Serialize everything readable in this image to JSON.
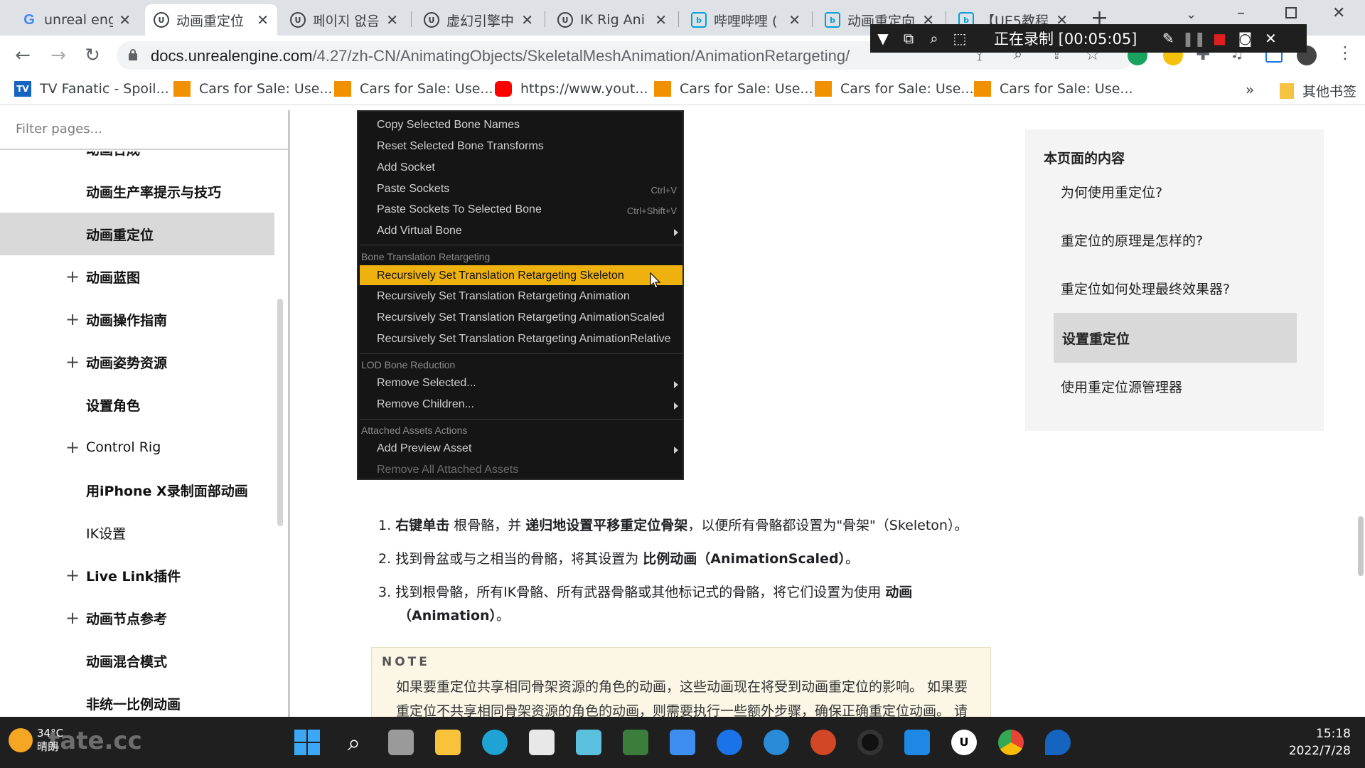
{
  "tabs": [
    {
      "title": "unreal eng",
      "icon": "google-icon",
      "active": false
    },
    {
      "title": "动画重定位",
      "icon": "unreal-icon",
      "active": true
    },
    {
      "title": "페이지 없음",
      "icon": "unreal-icon",
      "active": false
    },
    {
      "title": "虚幻引擎中",
      "icon": "unreal-icon",
      "active": false
    },
    {
      "title": "IK Rig Ani",
      "icon": "unreal-icon",
      "active": false
    },
    {
      "title": "哔哩哔哩 (",
      "icon": "bilibili-icon",
      "active": false
    },
    {
      "title": "动画重定向",
      "icon": "bilibili-icon",
      "active": false
    },
    {
      "title": "【UE5教程",
      "icon": "bilibili-icon",
      "active": false
    }
  ],
  "address": {
    "host": "docs.unrealengine.com",
    "path": "/4.27/zh-CN/AnimatingObjects/SkeletalMeshAnimation/AnimationRetargeting/"
  },
  "recorder": {
    "status": "正在录制 [00:05:05]"
  },
  "bookmarks": [
    {
      "label": "TV Fanatic - Spoil...",
      "icon": "tv-fanatic-icon"
    },
    {
      "label": "Cars for Sale: Use...",
      "icon": "cars-icon"
    },
    {
      "label": "Cars for Sale: Use...",
      "icon": "cars-icon"
    },
    {
      "label": "https://www.yout...",
      "icon": "youtube-icon"
    },
    {
      "label": "Cars for Sale: Use...",
      "icon": "cars-icon"
    },
    {
      "label": "Cars for Sale: Use...",
      "icon": "cars-icon"
    },
    {
      "label": "Cars for Sale: Use...",
      "icon": "cars-icon"
    }
  ],
  "bookmarks_more": "»",
  "bookmarks_other": "其他书签",
  "sidebar": {
    "filter_placeholder": "Filter pages...",
    "items": [
      {
        "label": "动画合成",
        "expandable": false
      },
      {
        "label": "动画生产率提示与技巧",
        "expandable": false
      },
      {
        "label": "动画重定位",
        "expandable": false,
        "active": true
      },
      {
        "label": "动画蓝图",
        "expandable": true
      },
      {
        "label": "动画操作指南",
        "expandable": true
      },
      {
        "label": "动画姿势资源",
        "expandable": true
      },
      {
        "label": "设置角色",
        "expandable": false
      },
      {
        "label": "Control Rig",
        "expandable": true
      },
      {
        "label": "用iPhone X录制面部动画",
        "expandable": false
      },
      {
        "label": "IK设置",
        "expandable": false
      },
      {
        "label": "Live Link插件",
        "expandable": true
      },
      {
        "label": "动画节点参考",
        "expandable": true
      },
      {
        "label": "动画混合模式",
        "expandable": false
      },
      {
        "label": "非统一比例动画",
        "expandable": false
      }
    ]
  },
  "context_menu": {
    "items": [
      {
        "label": "Copy Selected Bone Names"
      },
      {
        "label": "Reset Selected Bone Transforms"
      },
      {
        "label": "Add Socket"
      },
      {
        "label": "Paste Sockets",
        "shortcut": "Ctrl+V"
      },
      {
        "label": "Paste Sockets To Selected Bone",
        "shortcut": "Ctrl+Shift+V"
      },
      {
        "label": "Add Virtual Bone",
        "submenu": true
      }
    ],
    "section_bone_translation": "Bone Translation Retargeting",
    "bone_translation": [
      {
        "label": "Recursively Set Translation Retargeting Skeleton",
        "highlighted": true
      },
      {
        "label": "Recursively Set Translation Retargeting Animation"
      },
      {
        "label": "Recursively Set Translation Retargeting AnimationScaled"
      },
      {
        "label": "Recursively Set Translation Retargeting AnimationRelative"
      }
    ],
    "section_lod": "LOD Bone Reduction",
    "lod": [
      {
        "label": "Remove Selected...",
        "submenu": true
      },
      {
        "label": "Remove Children...",
        "submenu": true
      }
    ],
    "section_attached": "Attached Assets Actions",
    "attached": [
      {
        "label": "Add Preview Asset",
        "submenu": true
      },
      {
        "label": "Remove All Attached Assets",
        "disabled": true
      }
    ]
  },
  "steps": [
    {
      "n": "1.",
      "b1": "右键单击",
      "t1": " 根骨骼，并 ",
      "b2": "递归地设置平移重定位骨架",
      "t2": "，以便所有骨骼都设置为\"骨架\"（Skeleton）。"
    },
    {
      "n": "2.",
      "t1": "找到骨盆或与之相当的骨骼，将其设置为 ",
      "b2": "比例动画（AnimationScaled）",
      "t2": "。"
    },
    {
      "n": "3.",
      "t1": "找到根骨骼，所有IK骨骼、所有武器骨骼或其他标记式的骨骼，将它们设置为使用 ",
      "b2": "动画",
      "line2": "（Animation）",
      "t2": "。"
    }
  ],
  "note": {
    "title": "NOTE",
    "line1": "如果要重定位共享相同骨架资源的角色的动画，这些动画现在将受到动画重定位的影响。 如果要",
    "line2": "重定位不共享相同骨架资源的角色的动画，则需要执行一些额外步骤，确保正确重定位动画。 请"
  },
  "toc": {
    "title": "本页面的内容",
    "items": [
      {
        "label": "为何使用重定位?"
      },
      {
        "label": "重定位的原理是怎样的?"
      },
      {
        "label": "重定位如何处理最终效果器?"
      },
      {
        "label": "设置重定位",
        "active": true
      },
      {
        "label": "使用重定位源管理器"
      }
    ]
  },
  "taskbar": {
    "weather_temp": "34°C",
    "weather_desc": "晴朗",
    "watermark": "tate.cc",
    "time": "15:18",
    "date": "2022/7/28"
  },
  "colors": {
    "menu_highlight": "#eeb10d",
    "menu_bg": "#151515",
    "note_bg": "#fbf6e6",
    "active_nav": "#d9d9d9",
    "taskbar": "#1f1f1f"
  }
}
